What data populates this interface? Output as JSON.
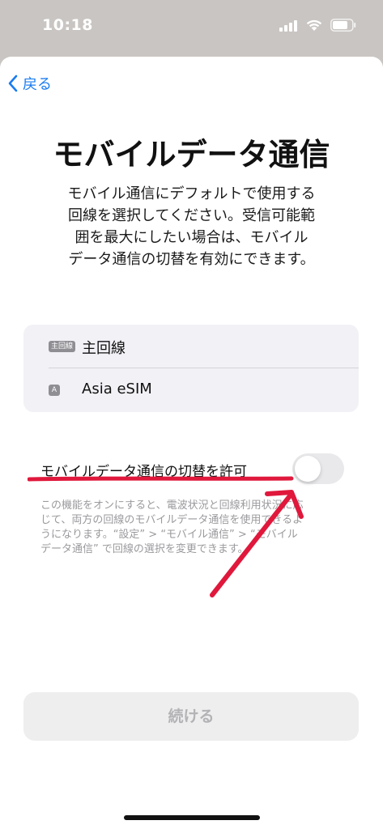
{
  "status_bar": {
    "time": "10:18",
    "icons": [
      "cellular-signal-icon",
      "wifi-icon",
      "battery-icon"
    ]
  },
  "nav": {
    "back_label": "戻る",
    "back_icon": "chevron-left-icon"
  },
  "title": "モバイルデータ通信",
  "description_lines": [
    "モバイル通信にデフォルトで使用する",
    "回線を選択してください。受信可能範",
    "囲を最大にしたい場合は、モバイル",
    "データ通信の切替を有効にできます。"
  ],
  "lines": [
    {
      "badge": "主回線",
      "label": "主回線"
    },
    {
      "badge": "A",
      "label": "Asia eSIM"
    }
  ],
  "toggle": {
    "label": "モバイルデータ通信の切替を許可",
    "state": "off"
  },
  "footnote_lines": [
    "この機能をオンにすると、電波状況と回線利用状況に応",
    "じて、両方の回線のモバイルデータ通信を使用できるよ",
    "うになります。“設定” > “モバイル通信” > “モバイル",
    "データ通信” で回線の選択を変更できます。"
  ],
  "continue_button": {
    "label": "続ける",
    "enabled": false
  },
  "colors": {
    "accent": "#1a7cf0",
    "annotation": "#e0183c",
    "toggle_off": "#e9e9eb",
    "button_disabled_bg": "#eeeeef",
    "button_disabled_text": "#b3b3b6"
  }
}
